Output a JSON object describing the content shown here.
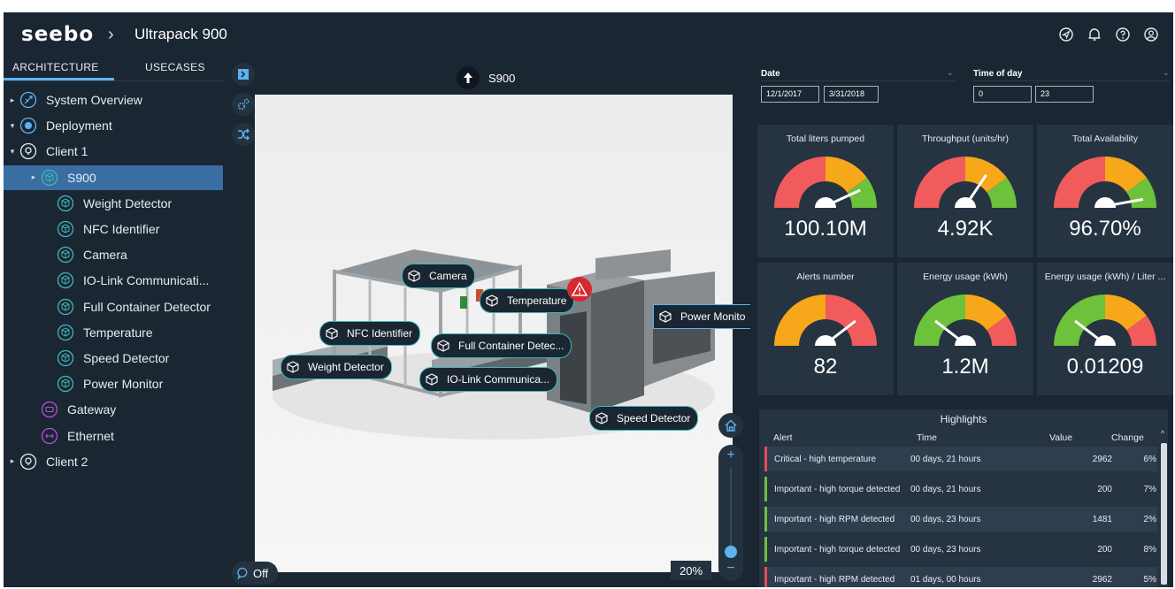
{
  "header": {
    "logo": "seebo",
    "separator": "›",
    "title": "Ultrapack 900"
  },
  "top_icons": [
    "navigate-icon",
    "bell-icon",
    "help-icon",
    "user-icon"
  ],
  "left_panel": {
    "tabs": [
      {
        "label": "ARCHITECTURE",
        "active": true
      },
      {
        "label": "USECASES",
        "active": false
      }
    ],
    "tree": [
      {
        "label": "System Overview",
        "icon": "overview-icon",
        "level": 0,
        "caret": "▸"
      },
      {
        "label": "Deployment",
        "icon": "deployment-icon",
        "level": 0,
        "caret": "▾"
      },
      {
        "label": "Client 1",
        "icon": "location-icon",
        "level": 0,
        "caret": "▾"
      },
      {
        "label": "S900",
        "icon": "cube-icon",
        "level": 1,
        "caret": "▸",
        "selected": true
      },
      {
        "label": "Weight Detector",
        "icon": "cube-icon",
        "level": 2
      },
      {
        "label": "NFC Identifier",
        "icon": "cube-icon",
        "level": 2
      },
      {
        "label": "Camera",
        "icon": "cube-icon",
        "level": 2
      },
      {
        "label": "IO-Link Communicati...",
        "icon": "cube-icon",
        "level": 2
      },
      {
        "label": "Full Container Detector",
        "icon": "cube-icon",
        "level": 2
      },
      {
        "label": "Temperature",
        "icon": "cube-icon",
        "level": 2
      },
      {
        "label": "Speed Detector",
        "icon": "cube-icon",
        "level": 2
      },
      {
        "label": "Power Monitor",
        "icon": "cube-icon",
        "level": 2
      },
      {
        "label": "Gateway",
        "icon": "gateway-icon",
        "level": 1
      },
      {
        "label": "Ethernet",
        "icon": "ethernet-icon",
        "level": 1
      },
      {
        "label": "Client 2",
        "icon": "location-icon",
        "level": 0,
        "caret": "▸"
      }
    ]
  },
  "viewer": {
    "model_label": "S900",
    "tags": [
      "Camera",
      "Temperature",
      "Power Monito",
      "NFC Identifier",
      "Full Container Detec...",
      "Weight Detector",
      "IO-Link Communica...",
      "Speed Detector"
    ],
    "toggle_label": "Off",
    "zoom": "20%",
    "zoom_plus": "+",
    "zoom_minus": "−"
  },
  "filters": {
    "date_label": "Date",
    "date_from": "12/1/2017",
    "date_to": "3/31/2018",
    "time_label": "Time of day",
    "time_from": "0",
    "time_to": "23"
  },
  "gauges": [
    {
      "title": "Total liters pumped",
      "value": "100.10M",
      "level": 0.85,
      "scheme": "good-high"
    },
    {
      "title": "Throughput (units/hr)",
      "value": "4.92K",
      "level": 0.68,
      "scheme": "good-high"
    },
    {
      "title": "Total Availability",
      "value": "96.70%",
      "level": 0.93,
      "scheme": "good-high"
    },
    {
      "title": "Alerts number",
      "value": "82",
      "level": 0.78,
      "scheme": "bad-high"
    },
    {
      "title": "Energy usage (kWh)",
      "value": "1.2M",
      "level": 0.22,
      "scheme": "energy"
    },
    {
      "title": "Energy usage (kWh) / Liter ...",
      "value": "0.01209",
      "level": 0.22,
      "scheme": "energy"
    }
  ],
  "highlights": {
    "title": "Highlights",
    "columns": [
      "Alert",
      "Time",
      "Value",
      "Change"
    ],
    "rows": [
      {
        "alert": "Critical - high temperature",
        "time": "00 days, 21 hours",
        "value": "2962",
        "change": "6%",
        "severity": "critical"
      },
      {
        "alert": "Important - high torque detected",
        "time": "00 days, 21 hours",
        "value": "200",
        "change": "7%",
        "severity": "important"
      },
      {
        "alert": "Important - high RPM detected",
        "time": "00 days, 23 hours",
        "value": "1481",
        "change": "2%",
        "severity": "important"
      },
      {
        "alert": "Important - high torque detected",
        "time": "00 days, 23 hours",
        "value": "200",
        "change": "8%",
        "severity": "important"
      },
      {
        "alert": "Important - high RPM detected",
        "time": "01 days, 00 hours",
        "value": "2962",
        "change": "5%",
        "severity": "critical"
      }
    ]
  },
  "colors": {
    "accent": "#5cb3f0",
    "teal": "#3db8b8",
    "red": "#f15b5b",
    "orange": "#f7a71a",
    "green": "#6cc23b",
    "critical": "#e54b55",
    "important": "#6cc23b"
  }
}
